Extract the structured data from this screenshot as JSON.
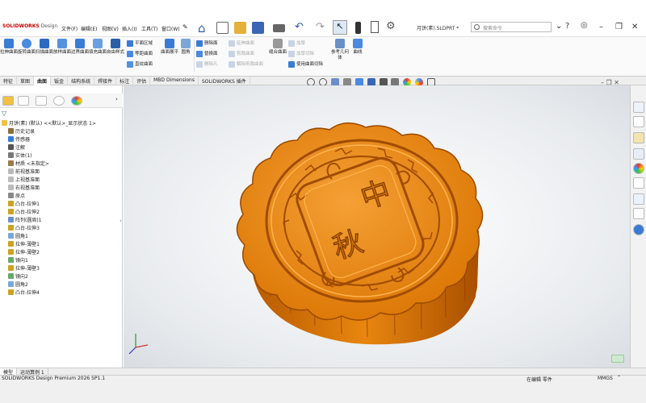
{
  "app": {
    "brand": "SOLIDWORKS",
    "brand_suffix": " Design",
    "filename": "月饼(素).SLDPRT *"
  },
  "menu": [
    "文件(F)",
    "编辑(E)",
    "视图(V)",
    "插入(I)",
    "工具(T)",
    "窗口(W)"
  ],
  "search": {
    "placeholder": "搜索命令"
  },
  "ribbon": {
    "big": [
      "拉伸曲面",
      "旋转曲面",
      "扫描曲面",
      "放样曲面",
      "边界曲面",
      "填充曲面",
      "自由样式"
    ],
    "group1": [
      "平面区域",
      "等距曲面",
      "直纹曲面"
    ],
    "group1b": [
      "曲面展平",
      "圆角"
    ],
    "group2": [
      "删除面",
      "替换面",
      "删除孔"
    ],
    "group2dis": [
      "延伸曲面",
      "剪裁曲面",
      "解除剪裁曲面"
    ],
    "knit": "缝合曲面",
    "group3": [
      "加厚",
      "加厚切除",
      "使用曲面切除"
    ],
    "refgeo": "参考几何体",
    "curves": "曲线"
  },
  "tabs": [
    "特征",
    "草图",
    "曲面",
    "钣金",
    "结构系统",
    "焊接件",
    "标注",
    "评估",
    "MBD Dimensions",
    "SOLIDWORKS 插件"
  ],
  "active_tab": "曲面",
  "tree": {
    "root": "月饼(素) (默认) <<默认>_显示状态 1>",
    "items": [
      {
        "label": "历史记录",
        "indent": true,
        "color": "#8a6d3b"
      },
      {
        "label": "传感器",
        "indent": true,
        "color": "#3a7bd5"
      },
      {
        "label": "注解",
        "indent": true,
        "color": "#555555"
      },
      {
        "label": "实体(1)",
        "indent": true,
        "color": "#777777"
      },
      {
        "label": "材质 <未指定>",
        "indent": true,
        "color": "#9c7a4a"
      },
      {
        "label": "前视基准面",
        "indent": true,
        "color": "#bbbbbb"
      },
      {
        "label": "上视基准面",
        "indent": true,
        "color": "#bbbbbb"
      },
      {
        "label": "右视基准面",
        "indent": true,
        "color": "#bbbbbb"
      },
      {
        "label": "原点",
        "indent": true,
        "color": "#888888"
      },
      {
        "label": "凸台-拉伸1",
        "indent": true,
        "color": "#c9a227"
      },
      {
        "label": "凸台-拉伸2",
        "indent": true,
        "color": "#c9a227"
      },
      {
        "label": "阵列(圆周)1",
        "indent": true,
        "color": "#6a8fc9"
      },
      {
        "label": "凸台-拉伸3",
        "indent": true,
        "color": "#c9a227"
      },
      {
        "label": "圆角1",
        "indent": true,
        "color": "#7aa6d8"
      },
      {
        "label": "拉伸-薄壁1",
        "indent": true,
        "color": "#c9a227"
      },
      {
        "label": "拉伸-薄壁2",
        "indent": true,
        "color": "#c9a227"
      },
      {
        "label": "镜向1",
        "indent": true,
        "color": "#6aa86a"
      },
      {
        "label": "拉伸-薄壁3",
        "indent": true,
        "color": "#c9a227"
      },
      {
        "label": "镜向2",
        "indent": true,
        "color": "#6aa86a"
      },
      {
        "label": "圆角2",
        "indent": true,
        "color": "#7aa6d8"
      },
      {
        "label": "凸台-拉伸4",
        "indent": true,
        "color": "#c9a227"
      }
    ]
  },
  "mooncake": {
    "char1": "中",
    "char2": "秋",
    "color": "#e07b00"
  },
  "bottom_tabs": [
    "模型",
    "运动算例 1"
  ],
  "status": {
    "left": "SOLIDWORKS Design Premium 2026 SP1.1",
    "middle": "在编辑 零件",
    "units": "MMGS"
  }
}
